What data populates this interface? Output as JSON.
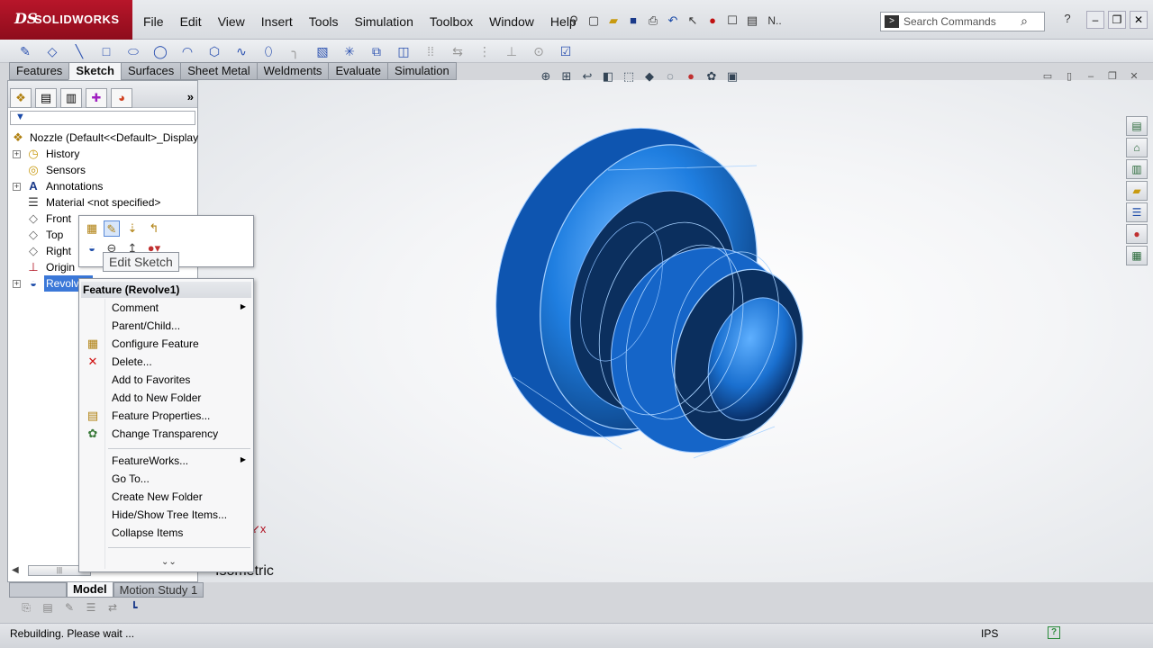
{
  "app": {
    "logo_mark": "DS",
    "logo_text": "SOLIDWORKS"
  },
  "menu": [
    "File",
    "Edit",
    "View",
    "Insert",
    "Tools",
    "Simulation",
    "Toolbox",
    "Window",
    "Help"
  ],
  "menu_right_text": "N..",
  "search": {
    "placeholder": "Search Commands"
  },
  "command_tabs": [
    "Features",
    "Sketch",
    "Surfaces",
    "Sheet Metal",
    "Weldments",
    "Evaluate",
    "Simulation"
  ],
  "active_command_tab": "Sketch",
  "feature_manager": {
    "root": "Nozzle  (Default<<Default>_Display",
    "items": [
      {
        "label": "History",
        "icon": "history-folder-icon",
        "expandable": true
      },
      {
        "label": "Sensors",
        "icon": "sensors-icon",
        "expandable": false
      },
      {
        "label": "Annotations",
        "icon": "annotations-icon",
        "expandable": true
      },
      {
        "label": "Material <not specified>",
        "icon": "material-icon",
        "expandable": false
      },
      {
        "label": "Front",
        "icon": "plane-icon",
        "expandable": false
      },
      {
        "label": "Top",
        "icon": "plane-icon",
        "expandable": false
      },
      {
        "label": "Right",
        "icon": "plane-icon",
        "expandable": false
      },
      {
        "label": "Origin",
        "icon": "origin-icon",
        "expandable": false
      },
      {
        "label": "Revolve1",
        "icon": "revolve-feature-icon",
        "expandable": true,
        "selected": true
      }
    ]
  },
  "tooltip": "Edit Sketch",
  "context_menu": {
    "header": "Feature (Revolve1)",
    "items": [
      {
        "label": "Comment",
        "submenu": true,
        "icon": ""
      },
      {
        "label": "Parent/Child...",
        "submenu": false,
        "icon": ""
      },
      {
        "label": "Configure Feature",
        "submenu": false,
        "icon": "configure-feature-icon"
      },
      {
        "label": "Delete...",
        "submenu": false,
        "icon": "delete-icon"
      },
      {
        "label": "Add to Favorites",
        "submenu": false,
        "icon": ""
      },
      {
        "label": "Add to New Folder",
        "submenu": false,
        "icon": ""
      },
      {
        "label": "Feature Properties...",
        "submenu": false,
        "icon": "feature-properties-icon"
      },
      {
        "label": "Change Transparency",
        "submenu": false,
        "icon": "change-transparency-icon"
      },
      {
        "label": "FeatureWorks...",
        "submenu": true,
        "icon": ""
      },
      {
        "label": "Go To...",
        "submenu": false,
        "icon": ""
      },
      {
        "label": "Create New Folder",
        "submenu": false,
        "icon": ""
      },
      {
        "label": "Hide/Show Tree Items...",
        "submenu": false,
        "icon": ""
      },
      {
        "label": "Collapse Items",
        "submenu": false,
        "icon": ""
      }
    ]
  },
  "view_label": "Isometric",
  "bottom_tabs": [
    "Model",
    "Motion Study 1"
  ],
  "active_bottom_tab": "Model",
  "status": {
    "message": "Rebuilding. Please wait ...",
    "units": "IPS"
  },
  "colors": {
    "model_blue": "#1f7ee0",
    "model_dark": "#0b2f5e",
    "selection": "#3b78d8",
    "logo_red": "#b8162a"
  }
}
